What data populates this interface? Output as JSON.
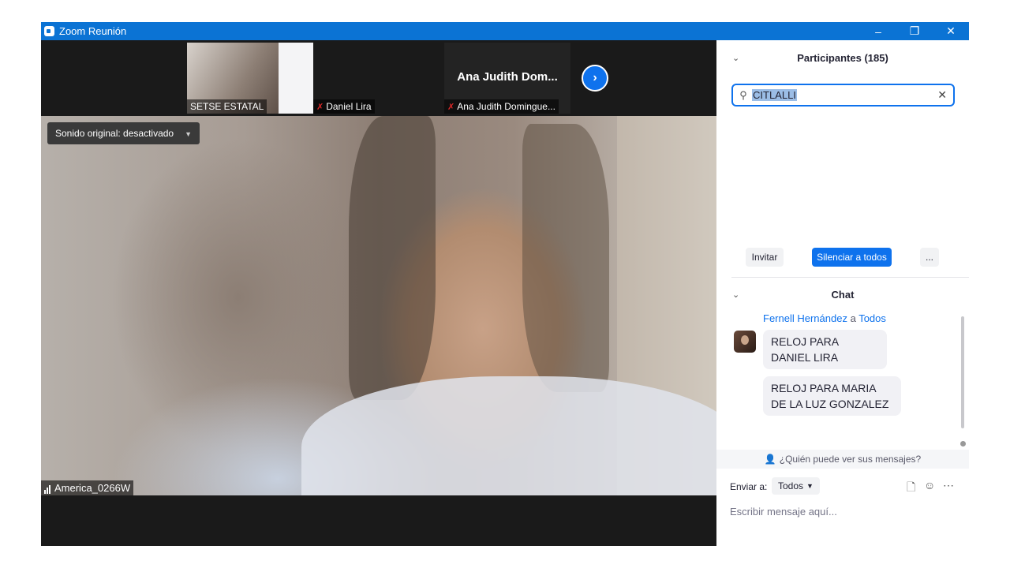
{
  "window": {
    "title": "Zoom Reunión",
    "controls": {
      "minimize": "–",
      "restore": "❐",
      "close": "✕"
    }
  },
  "video": {
    "thumbnails": [
      {
        "label": "SETSE ESTATAL",
        "muted": false
      },
      {
        "label": "Daniel Lira",
        "muted": true
      },
      {
        "label": "Ana Judith Domingue...",
        "display_name": "Ana Judith Dom...",
        "muted": true
      }
    ],
    "sound_menu": "Sonido original: desactivado",
    "active_speaker": "America_0266W"
  },
  "participants": {
    "heading": "Participantes (185)",
    "search_value": "CITLALLI",
    "actions": {
      "invite": "Invitar",
      "mute_all": "Silenciar a todos",
      "more": "..."
    }
  },
  "chat": {
    "heading": "Chat",
    "messages": {
      "sender": "Fernell Hernández",
      "to_word": "a",
      "recipient": "Todos",
      "lines": [
        "RELOJ PARA DANIEL LIRA",
        "RELOJ PARA MARIA DE LA LUZ GONZALEZ"
      ]
    },
    "privacy_note": "¿Quién puede ver sus mensajes?",
    "send_to_label": "Enviar a:",
    "send_to_value": "Todos",
    "compose_placeholder": "Escribir mensaje aquí..."
  },
  "icons": [
    "video-camera-icon",
    "chevron-right-icon",
    "mic-muted-icon",
    "signal-bars-icon",
    "chevron-down-icon",
    "search-icon",
    "clear-icon",
    "file-icon",
    "emoji-icon",
    "more-icon",
    "person-icon"
  ],
  "colors": {
    "titlebar": "#0b73d4",
    "accent": "#0e72ed",
    "video_bg": "#1a1a1a",
    "muted_red": "#e02828"
  }
}
